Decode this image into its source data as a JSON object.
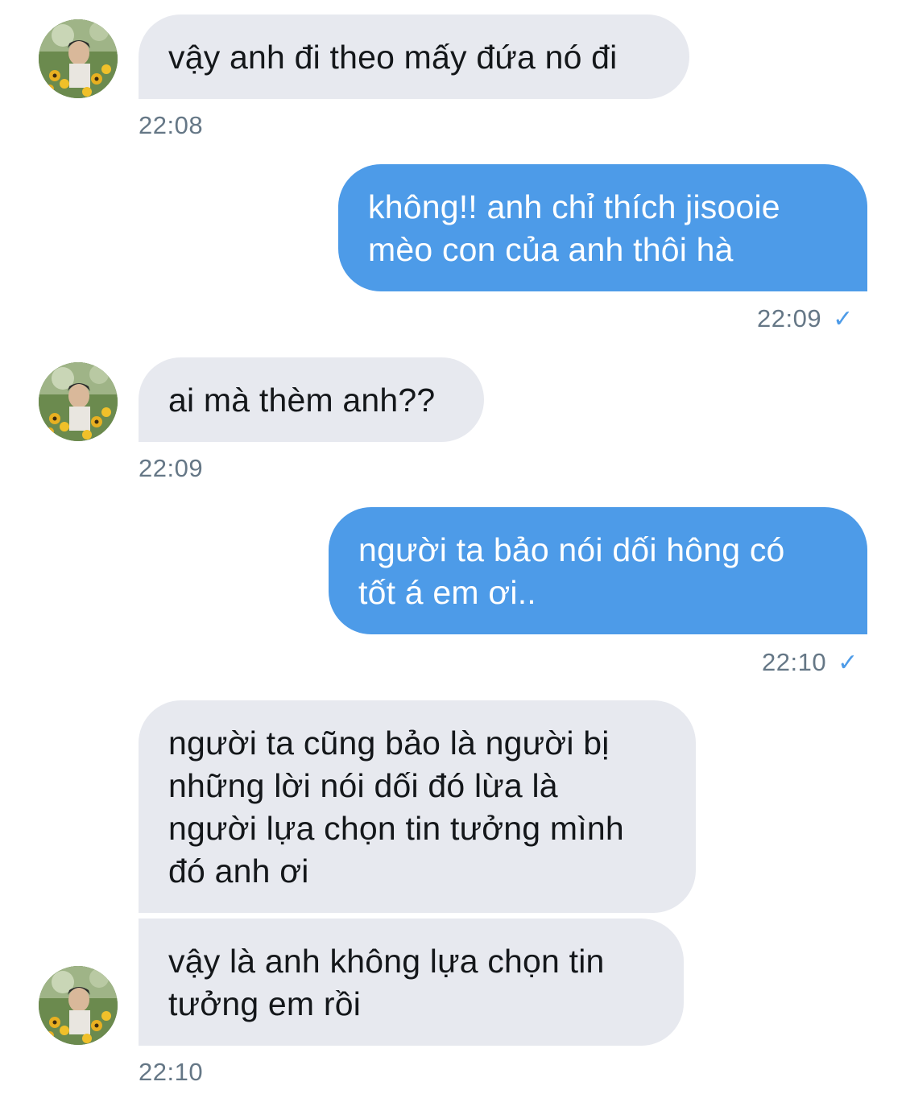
{
  "messages": [
    {
      "direction": "in",
      "text": "vậy anh đi theo mấy đứa nó đi",
      "time": "22:08"
    },
    {
      "direction": "out",
      "text": "không!! anh chỉ thích jisooie\nmèo con của anh thôi hà",
      "time": "22:09",
      "status_icon": "check-icon"
    },
    {
      "direction": "in",
      "text": "ai mà thèm anh??",
      "time": "22:09"
    },
    {
      "direction": "out",
      "text": "người ta bảo nói dối hông có\ntốt á em ơi..",
      "time": "22:10",
      "status_icon": "check-icon"
    },
    {
      "direction": "in",
      "text": "người ta cũng bảo là người bị\nnhững lời nói dối đó lừa là\nngười lựa chọn tin tưởng mình\nđó anh ơi"
    },
    {
      "direction": "in",
      "text": "vậy là anh không lựa chọn tin\ntưởng em rồi",
      "time": "22:10"
    }
  ],
  "glyphs": {
    "check": "✓"
  },
  "colors": {
    "incoming_bubble": "#e7e9ef",
    "outgoing_bubble": "#4d9be8",
    "timestamp": "#657786",
    "incoming_text": "#14171a",
    "outgoing_text": "#ffffff"
  }
}
